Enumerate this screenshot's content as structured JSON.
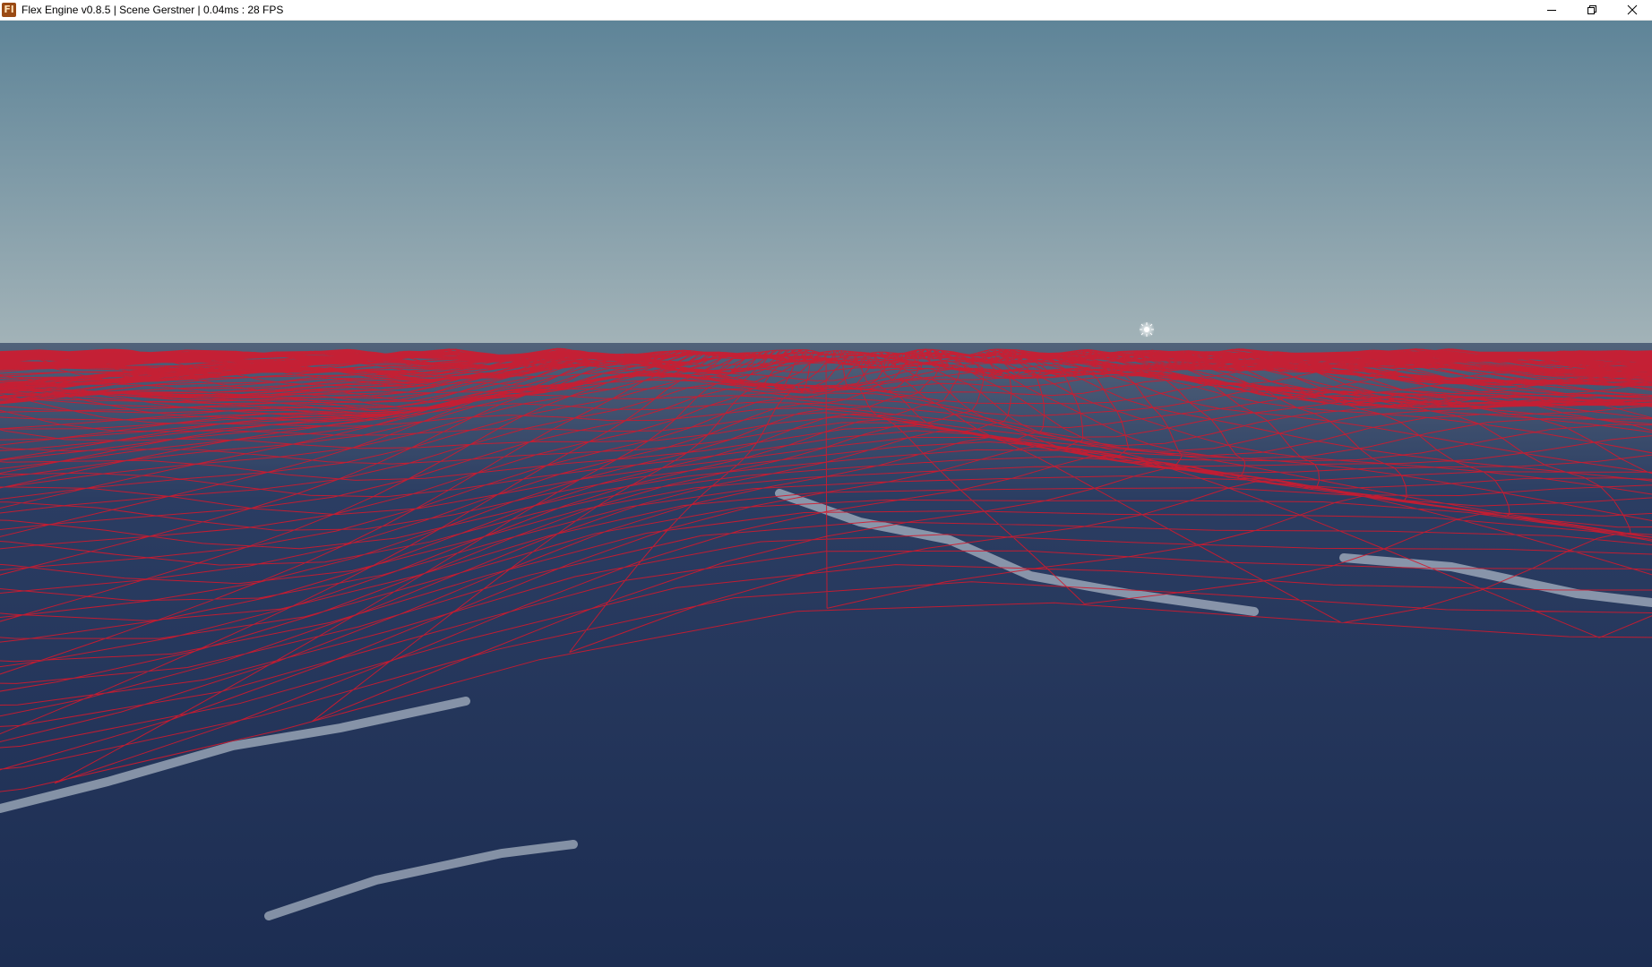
{
  "window": {
    "title": "Flex Engine v0.8.5 | Scene Gerstner | 0.04ms : 28 FPS",
    "app_icon_label": "Fl"
  },
  "controls": {
    "minimize": "minimize-icon",
    "restore": "restore-icon",
    "close": "close-icon"
  },
  "scene": {
    "sky_top_color": "#5e8498",
    "sky_horizon_color": "#a3b3b8",
    "water_color": "#1c2d52",
    "wireframe_color": "#d21a2e",
    "foam_color": "#d7e0e8",
    "sun_icon": "sun-icon"
  }
}
